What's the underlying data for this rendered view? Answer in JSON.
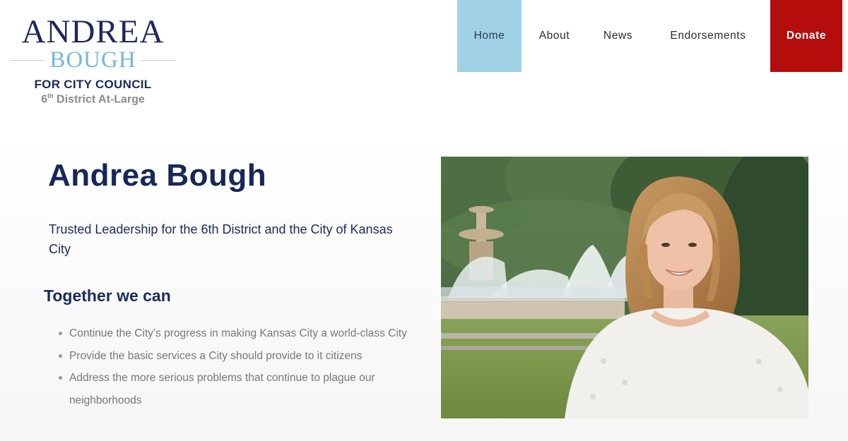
{
  "logo": {
    "first_name": "ANDREA",
    "last_name": "BOUGH",
    "council": "FOR CITY COUNCIL",
    "district_number": "6",
    "district_suffix": "th",
    "district_rest": " District At-Large"
  },
  "nav": {
    "items": [
      {
        "label": "Home",
        "active": true
      },
      {
        "label": "About"
      },
      {
        "label": "News"
      },
      {
        "label": "Endorsements"
      },
      {
        "label": "Donate"
      }
    ]
  },
  "hero": {
    "title": "Andrea Bough",
    "subtitle": "Trusted Leadership for the 6th District and the City of Kansas City",
    "together_heading": "Together we can",
    "goals": [
      "Continue the City’s progress in making Kansas City a world-class City",
      "Provide the basic services a City should provide to it citizens",
      "Address the more serious problems that continue to plague our neighborhoods"
    ]
  },
  "colors": {
    "brand_navy": "#1b2a5a",
    "brand_light_blue": "#a0d1e5",
    "donate_red": "#b50c0c"
  }
}
